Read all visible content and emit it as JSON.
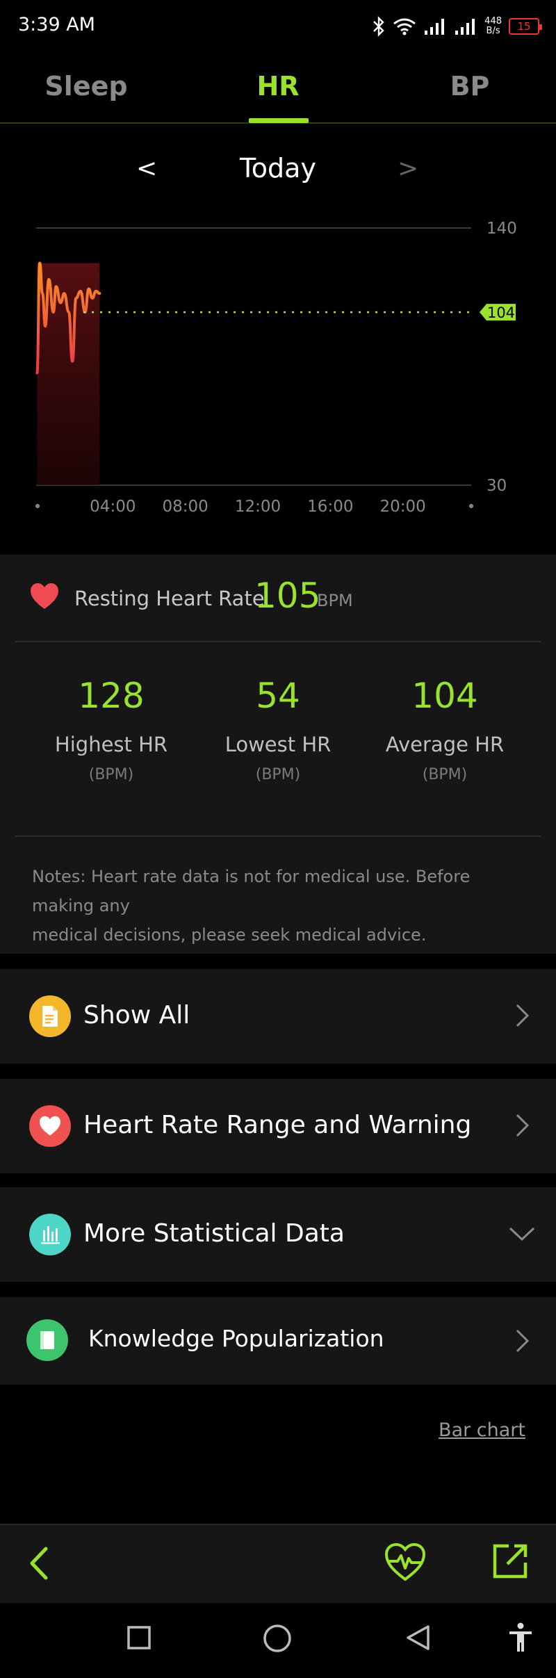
{
  "status_bar": {
    "time": "3:39 AM",
    "net_speed_value": "448",
    "net_speed_unit": "B/s",
    "battery": "15"
  },
  "tabs": [
    {
      "label": "Sleep",
      "active": false
    },
    {
      "label": "HR",
      "active": true
    },
    {
      "label": "BP",
      "active": false
    }
  ],
  "date_nav": {
    "prev": "<",
    "label": "Today",
    "next": ">"
  },
  "chart_data": {
    "type": "line",
    "x_ticks": [
      "04:00",
      "08:00",
      "12:00",
      "16:00",
      "20:00"
    ],
    "x_range_hours": [
      0,
      24
    ],
    "ylim": [
      30,
      140
    ],
    "y_ticks": [
      "140",
      "30"
    ],
    "reference_line": {
      "value": 104,
      "label": "104"
    },
    "series": [
      {
        "points": [
          {
            "hour": 0.05,
            "bpm": 78
          },
          {
            "hour": 0.2,
            "bpm": 125
          },
          {
            "hour": 0.35,
            "bpm": 112
          },
          {
            "hour": 0.5,
            "bpm": 98
          },
          {
            "hour": 0.7,
            "bpm": 118
          },
          {
            "hour": 0.95,
            "bpm": 104
          },
          {
            "hour": 1.1,
            "bpm": 115
          },
          {
            "hour": 1.35,
            "bpm": 108
          },
          {
            "hour": 1.55,
            "bpm": 112
          },
          {
            "hour": 1.8,
            "bpm": 104
          },
          {
            "hour": 2.0,
            "bpm": 83
          },
          {
            "hour": 2.2,
            "bpm": 110
          },
          {
            "hour": 2.45,
            "bpm": 113
          },
          {
            "hour": 2.7,
            "bpm": 104
          },
          {
            "hour": 2.9,
            "bpm": 114
          },
          {
            "hour": 3.1,
            "bpm": 110
          },
          {
            "hour": 3.3,
            "bpm": 113
          },
          {
            "hour": 3.5,
            "bpm": 112
          }
        ]
      }
    ],
    "colors": {
      "line_top": "#ff9a1f",
      "line_bottom": "#e8384a",
      "reference": "#b8e070",
      "reference_tag": "#9be22d"
    }
  },
  "resting_hr": {
    "label": "Resting Heart Rate",
    "value": "105",
    "unit": "BPM"
  },
  "stats": [
    {
      "value": "128",
      "name": "Highest HR",
      "unit": "(BPM)"
    },
    {
      "value": "54",
      "name": "Lowest HR",
      "unit": "(BPM)"
    },
    {
      "value": "104",
      "name": "Average HR",
      "unit": "(BPM)"
    }
  ],
  "notes_line1": "Notes: Heart rate data is not for medical use. Before making any",
  "notes_line2": "medical decisions, please seek medical advice.",
  "rows": [
    {
      "title": "Show All",
      "icon": "document-icon",
      "icon_color": "#f4b62a",
      "chevron": "chevron-right-icon"
    },
    {
      "title": "Heart Rate Range and Warning",
      "icon": "heart-icon",
      "icon_color": "#f05252",
      "chevron": "chevron-right-icon"
    },
    {
      "title": "More Statistical Data",
      "icon": "bar-stats-icon",
      "icon_color": "#4dd6c8",
      "chevron": "chevron-down-icon"
    },
    {
      "title": "Knowledge Popularization",
      "icon": "book-icon",
      "icon_color": "#3ec46d",
      "chevron": "chevron-right-icon"
    }
  ],
  "bar_chart_link": "Bar chart",
  "accent_color": "#9be22d"
}
